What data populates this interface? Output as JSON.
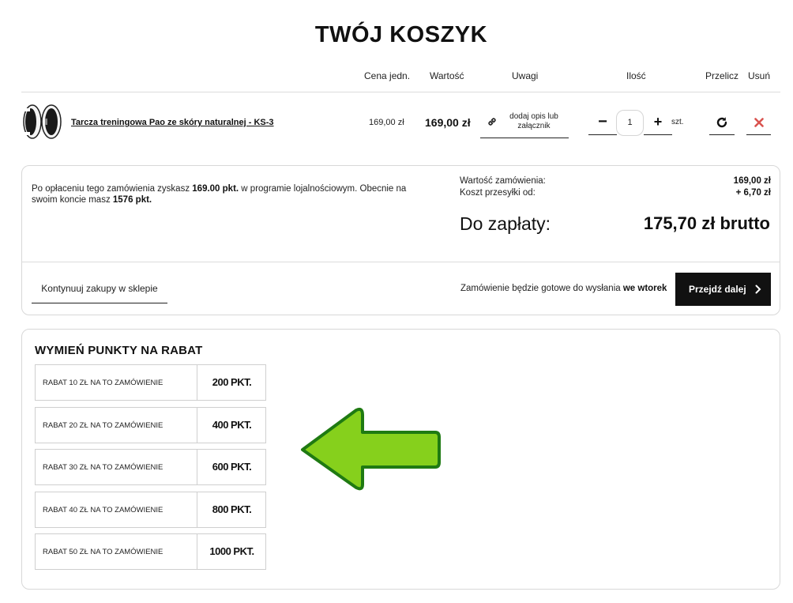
{
  "title": "TWÓJ KOSZYK",
  "cart": {
    "headers": {
      "unit_price": "Cena jedn.",
      "value": "Wartość",
      "notes": "Uwagi",
      "quantity": "Ilość",
      "recalc": "Przelicz",
      "remove": "Usuń"
    },
    "item": {
      "name": "Tarcza treningowa Pao ze skóry naturalnej - KS-3",
      "unit_price": "169,00 zł",
      "total": "169,00 zł",
      "notes_label": "dodaj opis lub załącznik",
      "quantity": "1",
      "quantity_unit": "szt."
    }
  },
  "summary": {
    "loyalty_part1": "Po opłaceniu tego zamówienia zyskasz ",
    "loyalty_points": "169.00 pkt.",
    "loyalty_part2": " w programie lojalnościowym. Obecnie na swoim koncie masz ",
    "loyalty_balance": "1576 pkt.",
    "order_value_label": "Wartość zamówienia:",
    "order_value": "169,00 zł",
    "shipping_label": "Koszt przesyłki od:",
    "shipping_value": "+ 6,70 zł",
    "to_pay_label": "Do zapłaty:",
    "to_pay_value": "175,70 zł brutto",
    "continue_label": "Kontynuuj zakupy w sklepie",
    "ready_text": "Zamówienie będzie gotowe do wysłania ",
    "ready_day": "we wtorek",
    "next_label": "Przejdź dalej"
  },
  "points": {
    "title": "WYMIEŃ PUNKTY NA RABAT",
    "rewards": [
      {
        "label": "RABAT 10 ZŁ NA TO ZAMÓWIENIE",
        "points": "200 PKT."
      },
      {
        "label": "RABAT 20 ZŁ NA TO ZAMÓWIENIE",
        "points": "400 PKT."
      },
      {
        "label": "RABAT 30 ZŁ NA TO ZAMÓWIENIE",
        "points": "600 PKT."
      },
      {
        "label": "RABAT 40 ZŁ NA TO ZAMÓWIENIE",
        "points": "800 PKT."
      },
      {
        "label": "RABAT 50 ZŁ NA TO ZAMÓWIENIE",
        "points": "1000 PKT."
      }
    ]
  },
  "icons": {
    "notes": "link-icon",
    "recalc": "refresh-icon",
    "remove": "close-icon",
    "next": "chevron-right-icon",
    "overlay": "green-left-arrow"
  },
  "colors": {
    "remove_icon": "#d9534f",
    "primary_button": "#111111",
    "arrow_fill": "#86d01c",
    "arrow_stroke": "#1f7a12"
  }
}
